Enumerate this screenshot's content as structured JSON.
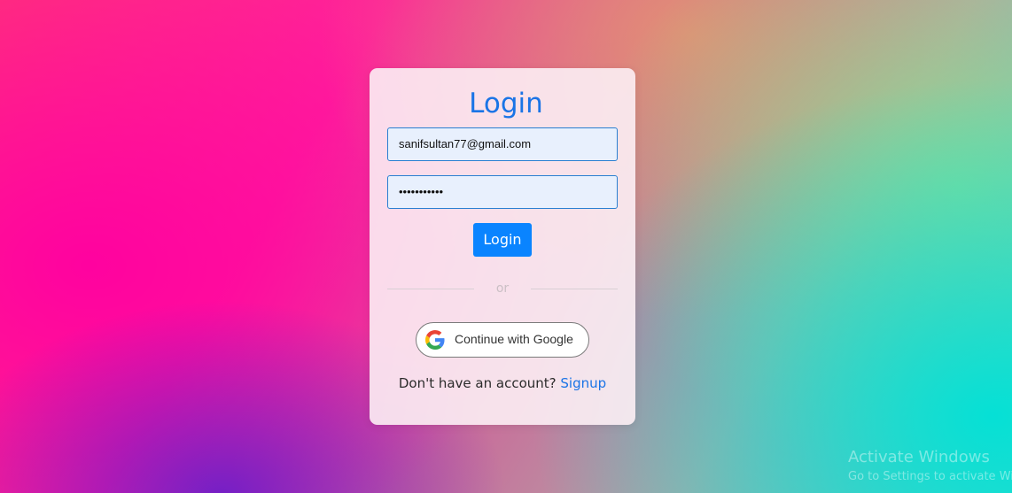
{
  "login_form": {
    "title": "Login",
    "email_value": "sanifsultan77@gmail.com",
    "password_masked": "•••••••••••",
    "login_button_label": "Login",
    "divider_text": "or",
    "google_button_label": "Continue with Google",
    "google_icon": "google-g-icon",
    "signup_prompt": "Don't have an account?",
    "signup_link_label": "Signup"
  },
  "colors": {
    "accent": "#1a74e6",
    "button": "#0a84ff",
    "input_background": "#e8f0fd",
    "input_border": "#2a7fd1"
  },
  "os_watermark": {
    "title": "Activate Windows",
    "subtitle": "Go to Settings to activate Windows."
  }
}
